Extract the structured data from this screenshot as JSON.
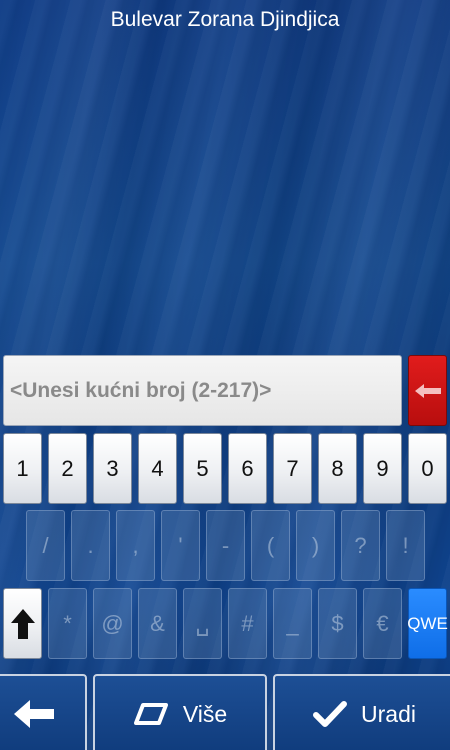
{
  "header": {
    "title": "Bulevar Zorana Djindjica"
  },
  "input": {
    "placeholder": "<Unesi kućni broj (2-217)>",
    "value": ""
  },
  "keyboard": {
    "row1": [
      "1",
      "2",
      "3",
      "4",
      "5",
      "6",
      "7",
      "8",
      "9",
      "0"
    ],
    "row2": [
      "/",
      ".",
      ",",
      "'",
      "-",
      "(",
      ")",
      "?",
      "!"
    ],
    "row3": [
      "*",
      "@",
      "&",
      "␣",
      "#",
      "_",
      "$",
      "€"
    ],
    "qwe_label": "QWE",
    "backspace_color": "#d11414",
    "qwe_color": "#1a7cf5"
  },
  "bottom": {
    "back_label": "",
    "more_label": "Više",
    "done_label": "Uradi"
  }
}
